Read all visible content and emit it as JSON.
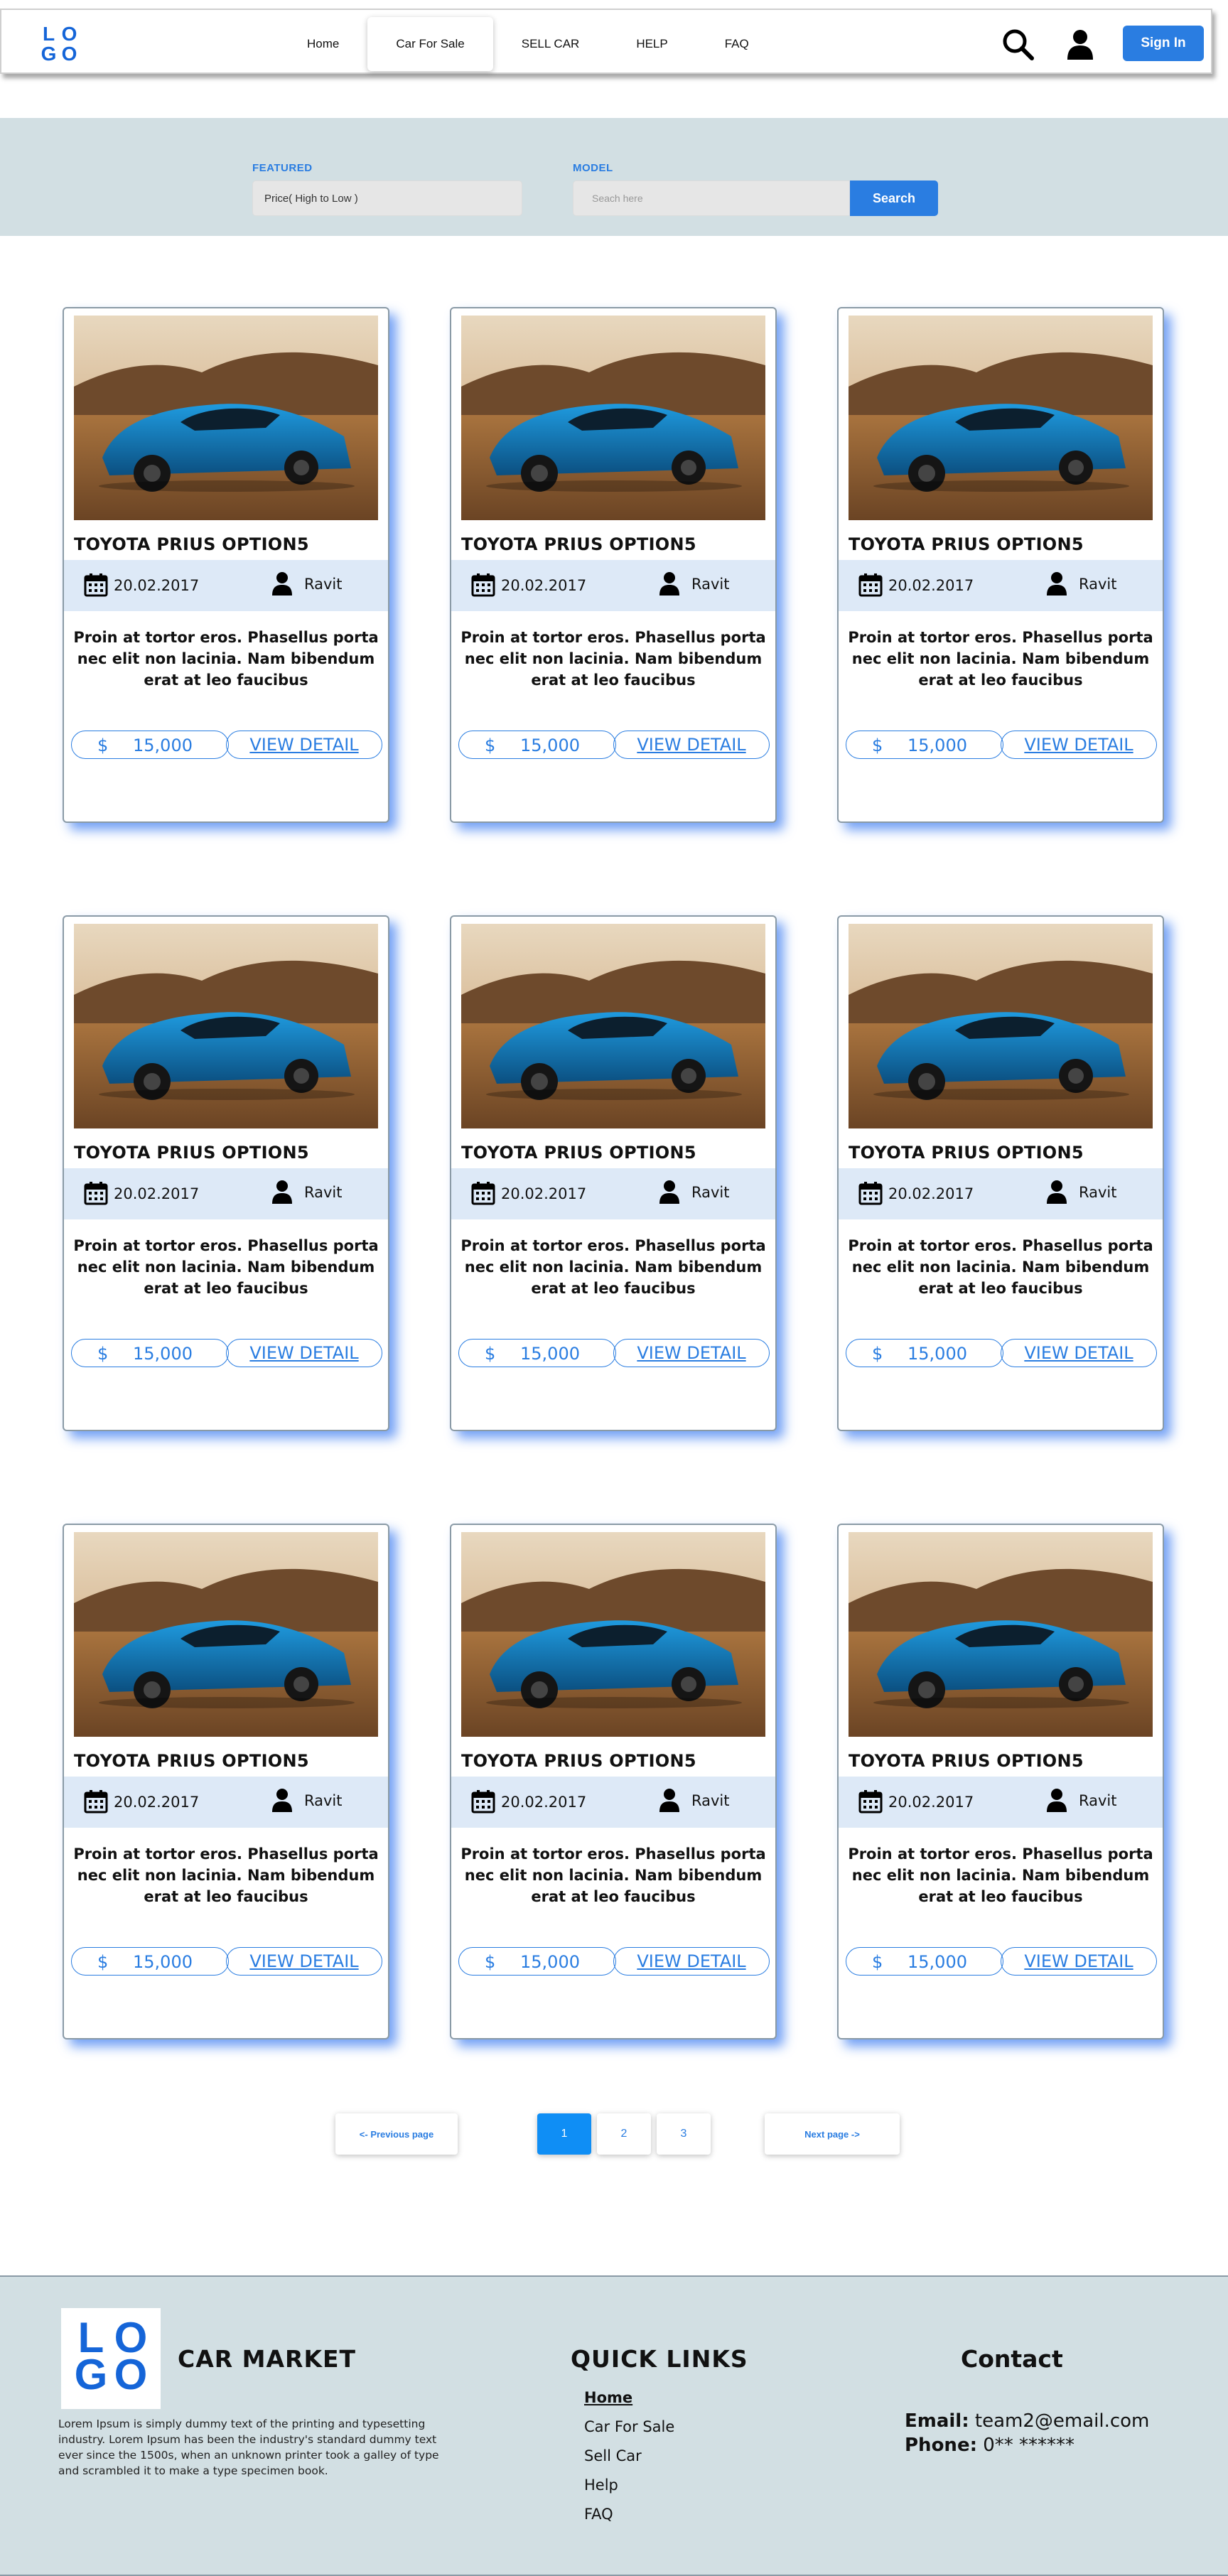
{
  "logo": {
    "letters": [
      "L",
      "O",
      "G",
      "O"
    ]
  },
  "nav": {
    "links": [
      "Home",
      "Car For Sale",
      "SELL CAR",
      "HELP",
      "FAQ"
    ],
    "active_index": 1,
    "signin_label": "Sign In",
    "search_icon": "search-icon",
    "user_icon": "user-icon"
  },
  "filters": {
    "featured_label": "FEATURED",
    "featured_value": "Price( High to Low )",
    "model_label": "MODEL",
    "model_placeholder": "Seach here",
    "search_button": "Search"
  },
  "cards": [
    {
      "title": "TOYOTA PRIUS OPTION5",
      "date": "20.02.2017",
      "author": "Ravit",
      "description": "Proin at tortor eros. Phasellus porta nec elit non lacinia. Nam bibendum erat at leo faucibus",
      "currency": "$",
      "price": "15,000",
      "detail_label": "VIEW DETAIL"
    },
    {
      "title": "TOYOTA PRIUS OPTION5",
      "date": "20.02.2017",
      "author": "Ravit",
      "description": "Proin at tortor eros. Phasellus porta nec elit non lacinia. Nam bibendum erat at leo faucibus",
      "currency": "$",
      "price": "15,000",
      "detail_label": "VIEW DETAIL"
    },
    {
      "title": "TOYOTA PRIUS OPTION5",
      "date": "20.02.2017",
      "author": "Ravit",
      "description": "Proin at tortor eros. Phasellus porta nec elit non lacinia. Nam bibendum erat at leo faucibus",
      "currency": "$",
      "price": "15,000",
      "detail_label": "VIEW DETAIL"
    },
    {
      "title": "TOYOTA PRIUS OPTION5",
      "date": "20.02.2017",
      "author": "Ravit",
      "description": "Proin at tortor eros. Phasellus porta nec elit non lacinia. Nam bibendum erat at leo faucibus",
      "currency": "$",
      "price": "15,000",
      "detail_label": "VIEW DETAIL"
    },
    {
      "title": "TOYOTA PRIUS OPTION5",
      "date": "20.02.2017",
      "author": "Ravit",
      "description": "Proin at tortor eros. Phasellus porta nec elit non lacinia. Nam bibendum erat at leo faucibus",
      "currency": "$",
      "price": "15,000",
      "detail_label": "VIEW DETAIL"
    },
    {
      "title": "TOYOTA PRIUS OPTION5",
      "date": "20.02.2017",
      "author": "Ravit",
      "description": "Proin at tortor eros. Phasellus porta nec elit non lacinia. Nam bibendum erat at leo faucibus",
      "currency": "$",
      "price": "15,000",
      "detail_label": "VIEW DETAIL"
    },
    {
      "title": "TOYOTA PRIUS OPTION5",
      "date": "20.02.2017",
      "author": "Ravit",
      "description": "Proin at tortor eros. Phasellus porta nec elit non lacinia. Nam bibendum erat at leo faucibus",
      "currency": "$",
      "price": "15,000",
      "detail_label": "VIEW DETAIL"
    },
    {
      "title": "TOYOTA PRIUS OPTION5",
      "date": "20.02.2017",
      "author": "Ravit",
      "description": "Proin at tortor eros. Phasellus porta nec elit non lacinia. Nam bibendum erat at leo faucibus",
      "currency": "$",
      "price": "15,000",
      "detail_label": "VIEW DETAIL"
    },
    {
      "title": "TOYOTA PRIUS OPTION5",
      "date": "20.02.2017",
      "author": "Ravit",
      "description": "Proin at tortor eros. Phasellus porta nec elit non lacinia. Nam bibendum erat at leo faucibus",
      "currency": "$",
      "price": "15,000",
      "detail_label": "VIEW DETAIL"
    }
  ],
  "pagination": {
    "prev_label": "<- Previous page",
    "pages": [
      "1",
      "2",
      "3"
    ],
    "active_index": 0,
    "next_label": "Next page ->"
  },
  "footer": {
    "brand": "CAR MARKET",
    "about": "Lorem Ipsum is simply dummy text of the printing and typesetting industry. Lorem Ipsum has been the industry's standard dummy text ever since the 1500s, when an unknown printer took a galley of type and scrambled it to make a type specimen book.",
    "quick_links_title": "QUICK LINKS",
    "quick_links": [
      "Home",
      "Car For Sale",
      "Sell Car",
      "Help",
      "FAQ"
    ],
    "contact_title": "Contact",
    "email_label": "Email:",
    "email_value": "team2@email.com",
    "phone_label": "Phone:",
    "phone_value": "0** ******"
  },
  "colors": {
    "accent": "#2a7de1",
    "logo": "#1565d8",
    "band": "#d2dfe3",
    "meta_band": "#dde9f7",
    "page_active": "#0f8ef5"
  }
}
